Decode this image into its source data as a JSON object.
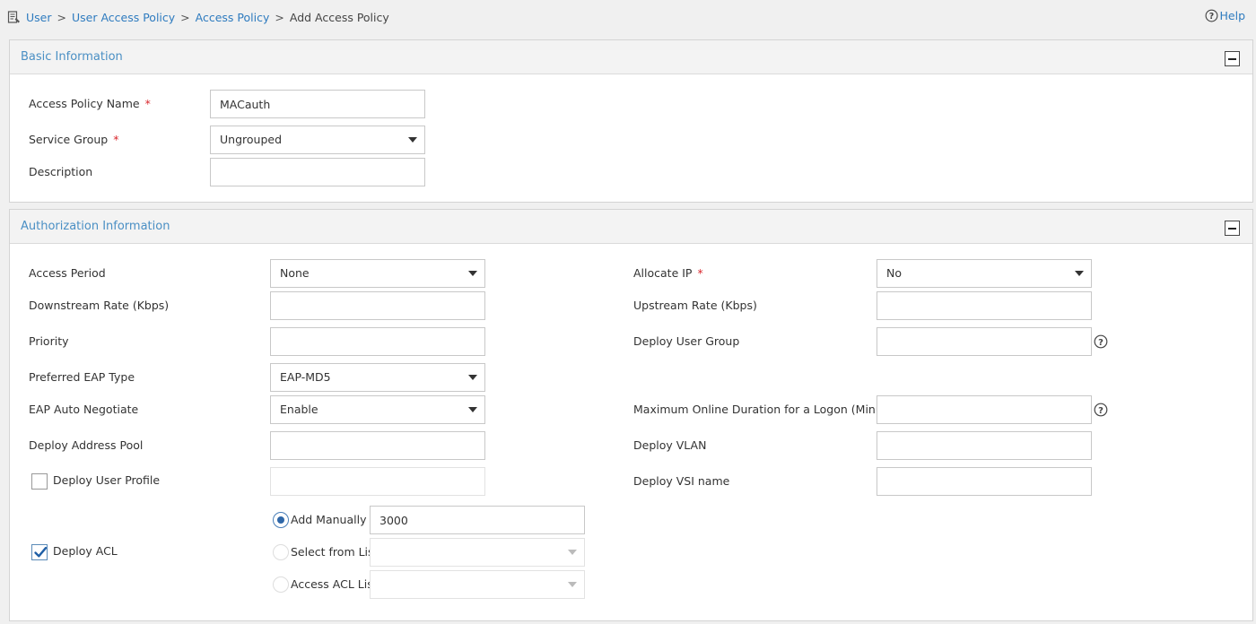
{
  "breadcrumb": {
    "items": [
      "User",
      "User Access Policy",
      "Access Policy"
    ],
    "separator": ">",
    "current": "Add Access Policy"
  },
  "help_label": "Help",
  "basic": {
    "title": "Basic Information",
    "policy_name_label": "Access Policy Name",
    "policy_name_value": "MACauth",
    "service_group_label": "Service Group",
    "service_group_value": "Ungrouped",
    "description_label": "Description",
    "description_value": "",
    "required_mark": "*"
  },
  "auth": {
    "title": "Authorization Information",
    "required_mark": "*",
    "access_period_label": "Access Period",
    "access_period_value": "None",
    "downstream_label": "Downstream Rate (Kbps)",
    "downstream_value": "",
    "priority_label": "Priority",
    "priority_value": "",
    "eap_type_label": "Preferred EAP Type",
    "eap_type_value": "EAP-MD5",
    "eap_negotiate_label": "EAP Auto Negotiate",
    "eap_negotiate_value": "Enable",
    "address_pool_label": "Deploy Address Pool",
    "address_pool_value": "",
    "user_profile_label": "Deploy User Profile",
    "user_profile_checked": false,
    "user_profile_value": "",
    "allocate_ip_label": "Allocate IP",
    "allocate_ip_value": "No",
    "upstream_label": "Upstream Rate (Kbps)",
    "upstream_value": "",
    "user_group_label": "Deploy User Group",
    "user_group_value": "",
    "max_online_label": "Maximum Online Duration for a Logon (Minutes)",
    "max_online_value": "",
    "vlan_label": "Deploy VLAN",
    "vlan_value": "",
    "vsi_label": "Deploy VSI name",
    "vsi_value": "",
    "acl_label": "Deploy ACL",
    "acl_checked": true,
    "acl_options": {
      "add_manually": "Add Manually",
      "select_from_list": "Select from List",
      "access_acl_list": "Access ACL List"
    },
    "acl_selected": "Add Manually",
    "acl_manual_value": "3000",
    "acl_select_value": "",
    "acl_access_value": ""
  },
  "colors": {
    "link": "#2e7bbf",
    "panel_title": "#4a8fc4",
    "required": "#d9262c",
    "checkmark": "#1f5fa6"
  },
  "icons": [
    "breadcrumb-menu-icon",
    "help-icon",
    "question-icon",
    "checkmark-icon",
    "collapse-icon"
  ]
}
